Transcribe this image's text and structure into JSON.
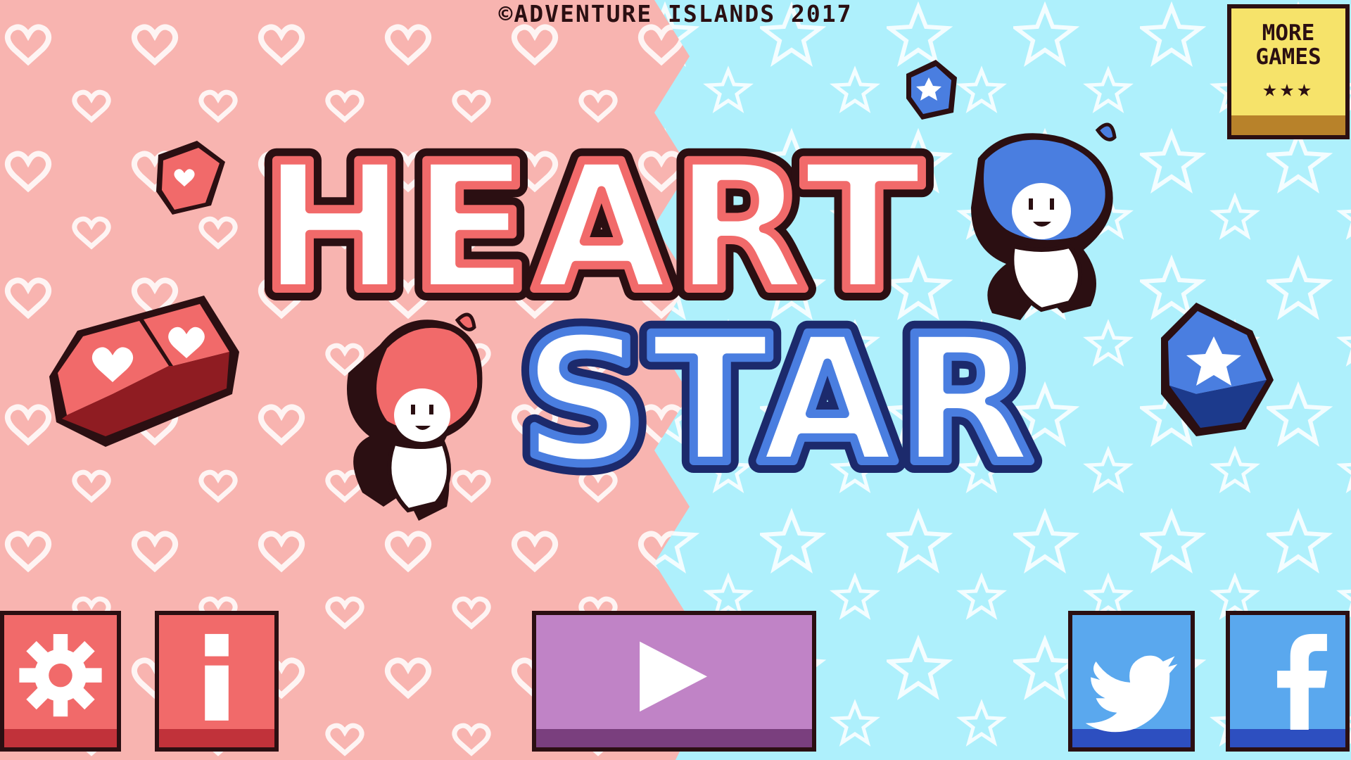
{
  "copyright": "©ADVENTURE ISLANDS 2017",
  "title": {
    "line1": "HEART",
    "line2": "STAR"
  },
  "more_games": {
    "line1": "MORE",
    "line2": "GAMES",
    "stars": "★★★"
  },
  "buttons": {
    "settings_icon": "gear-icon",
    "info_icon": "info-icon",
    "play_icon": "play-icon",
    "twitter_icon": "twitter-bird-icon",
    "facebook_icon": "facebook-f-icon"
  },
  "colors": {
    "pink_bg": "#f8b4b0",
    "blue_bg": "#aef0fc",
    "heart_red": "#f16a6a",
    "star_blue": "#5aa8ee",
    "play_purple": "#c083c6",
    "outline": "#2b0f12",
    "more_games_yellow": "#f6e36a"
  }
}
